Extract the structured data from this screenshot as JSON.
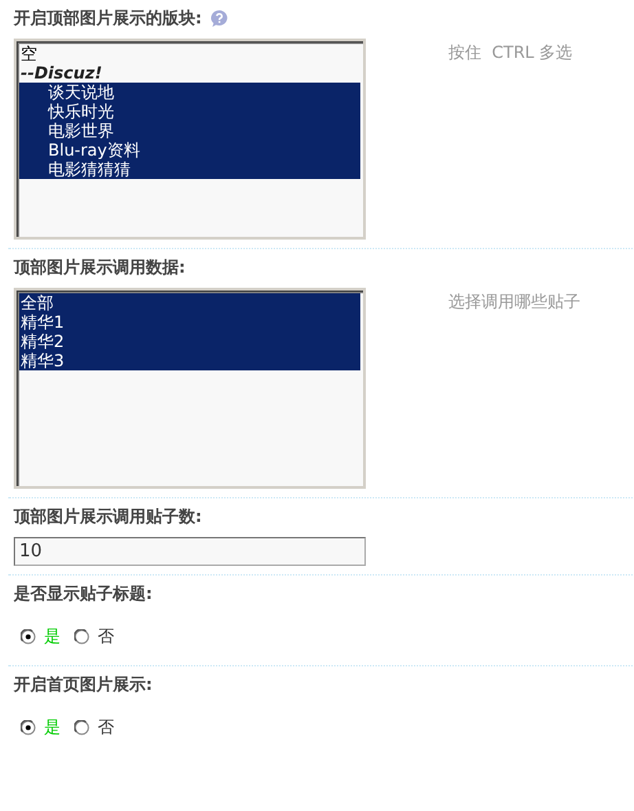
{
  "sections": [
    {
      "kind": "listbox",
      "title": "开启顶部图片展示的版块:",
      "help": true,
      "hint": "按住  CTRL 多选",
      "options": [
        {
          "kind": "option",
          "label": "空",
          "selected": false
        },
        {
          "kind": "group",
          "label": "--Discuz!",
          "selected": false,
          "children": [
            {
              "kind": "option",
              "label": "谈天说地",
              "selected": true
            },
            {
              "kind": "option",
              "label": "快乐时光",
              "selected": true
            },
            {
              "kind": "option",
              "label": "电影世界",
              "selected": true
            },
            {
              "kind": "option",
              "label": "Blu-ray资料",
              "selected": true
            },
            {
              "kind": "option",
              "label": "电影猜猜猜",
              "selected": true
            }
          ]
        }
      ]
    },
    {
      "kind": "listbox",
      "title": "顶部图片展示调用数据:",
      "help": false,
      "hint": "选择调用哪些贴子",
      "options": [
        {
          "kind": "option",
          "label": "全部",
          "selected": true
        },
        {
          "kind": "option",
          "label": "精华1",
          "selected": true
        },
        {
          "kind": "option",
          "label": "精华2",
          "selected": true
        },
        {
          "kind": "option",
          "label": "精华3",
          "selected": true
        }
      ]
    },
    {
      "kind": "text",
      "title": "顶部图片展示调用贴子数:",
      "help": false,
      "value": "10"
    },
    {
      "kind": "radio",
      "title": "是否显示贴子标题:",
      "help": false,
      "options": [
        {
          "label": "是",
          "selected": true
        },
        {
          "label": "否",
          "selected": false
        }
      ]
    },
    {
      "kind": "radio",
      "title": "开启首页图片展示:",
      "help": false,
      "options": [
        {
          "label": "是",
          "selected": true
        },
        {
          "label": "否",
          "selected": false
        }
      ]
    }
  ]
}
